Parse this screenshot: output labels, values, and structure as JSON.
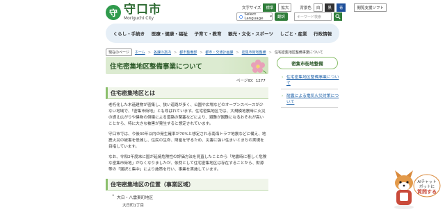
{
  "header": {
    "logo_mark": "守",
    "logo_jp": "守口市",
    "logo_en": "Moriguchi City",
    "font_size_label": "文字サイズ",
    "font_standard": "標準",
    "font_large": "拡大",
    "bg_color_label": "背景色",
    "bg_white": "白",
    "bg_black": "黒",
    "bg_blue": "青",
    "support_software": "閲覧支援ソフト",
    "language_select": "Select Language",
    "translate_button": "翻訳",
    "search_placeholder": "キーワード検索"
  },
  "nav": {
    "items": [
      "くらし・手続き",
      "医療・健康・福祉",
      "子育て・教育",
      "観光・文化・スポーツ",
      "しごと・産業",
      "行政情報"
    ]
  },
  "breadcrumb": {
    "here_label": "現在のページ",
    "items": [
      "ホーム",
      "各課の案内",
      "都市整備部",
      "都市・交通計画課",
      "密集市街地整備",
      "住宅密集地区整備事業について"
    ]
  },
  "main": {
    "title": "住宅密集地区整備事業について",
    "page_id": "ページID：1277",
    "section1_title": "住宅密集地区とは",
    "para1": "老朽化した木造建物が密集し、狭い道路が多く、公園や広場などのオープンスペースが少ない地域で、「密集市街地」とも呼ばれています。住宅密集地区では、大規模地震時に火災の燃え広がりや建物の倒壊による道路の閉塞などにより、避難が困難になるおそれが高いことから、特に大きな被害が発生すると想定されています。",
    "para2": "守口市では、今後30年以内の発生確率が70%と想定される南海トラフ地震などに備え、地震火災の被害を低減し、住民の生命、財産を守るため、災害に強い住まいとまちの実現を目指しています。",
    "para3": "なお、令和2年度末に国が延焼危険性の評価方法を見直したことから「地震時に著しく危険な密集市街地」がなくなりましたが、依然として住宅密集地区は存在することから、財源等の「選択と集中」により施策を行い、事業を実施しています。",
    "section2_title": "住宅密集地区の位置（事業区域）",
    "bullet1": "大日・八雲東町地区",
    "sub1": "大日町1丁目"
  },
  "sidebar": {
    "heading": "密集市街地整備",
    "links": [
      "住宅密集地区整備事業について",
      "耐震による電気火災対策について"
    ]
  },
  "chatbot": {
    "label": "AIチャットボットに質問する"
  },
  "colors": {
    "accent_green": "#2f7d3a",
    "title_bg": "#dcebd1",
    "nav_bg": "#e6eff7",
    "link": "#1a5fa8"
  }
}
